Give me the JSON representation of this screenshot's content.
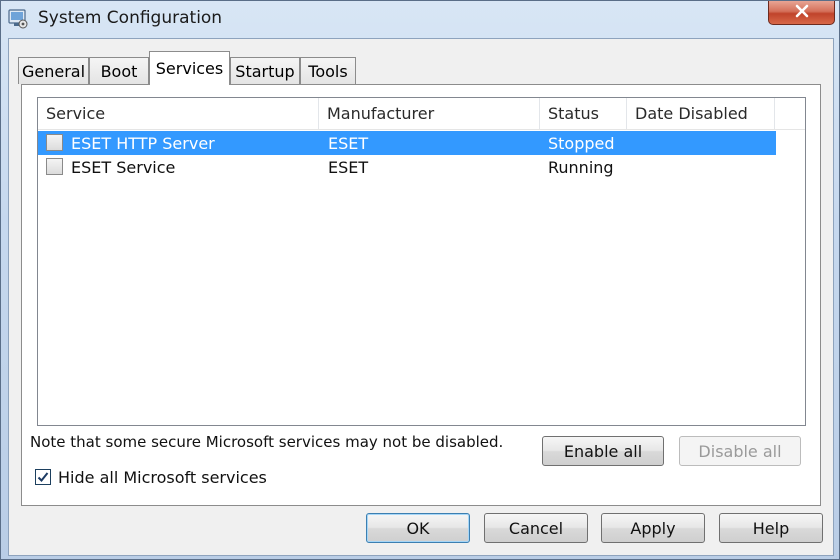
{
  "window": {
    "title": "System Configuration"
  },
  "tabs": [
    {
      "label": "General"
    },
    {
      "label": "Boot"
    },
    {
      "label": "Services",
      "active": true
    },
    {
      "label": "Startup"
    },
    {
      "label": "Tools"
    }
  ],
  "services": {
    "columns": [
      "Service",
      "Manufacturer",
      "Status",
      "Date Disabled"
    ],
    "rows": [
      {
        "service": "ESET HTTP Server",
        "manufacturer": "ESET",
        "status": "Stopped",
        "date_disabled": "",
        "checked": false,
        "selected": true
      },
      {
        "service": "ESET Service",
        "manufacturer": "ESET",
        "status": "Running",
        "date_disabled": "",
        "checked": false,
        "selected": false
      }
    ],
    "note": "Note that some secure Microsoft services may not be disabled.",
    "enable_all": "Enable all",
    "disable_all": "Disable all",
    "hide_ms_label": "Hide all Microsoft services",
    "hide_ms_checked": true
  },
  "footer": {
    "ok": "OK",
    "cancel": "Cancel",
    "apply": "Apply",
    "help": "Help"
  },
  "colors": {
    "selection": "#3399ff",
    "close_button": "#c0432b"
  }
}
